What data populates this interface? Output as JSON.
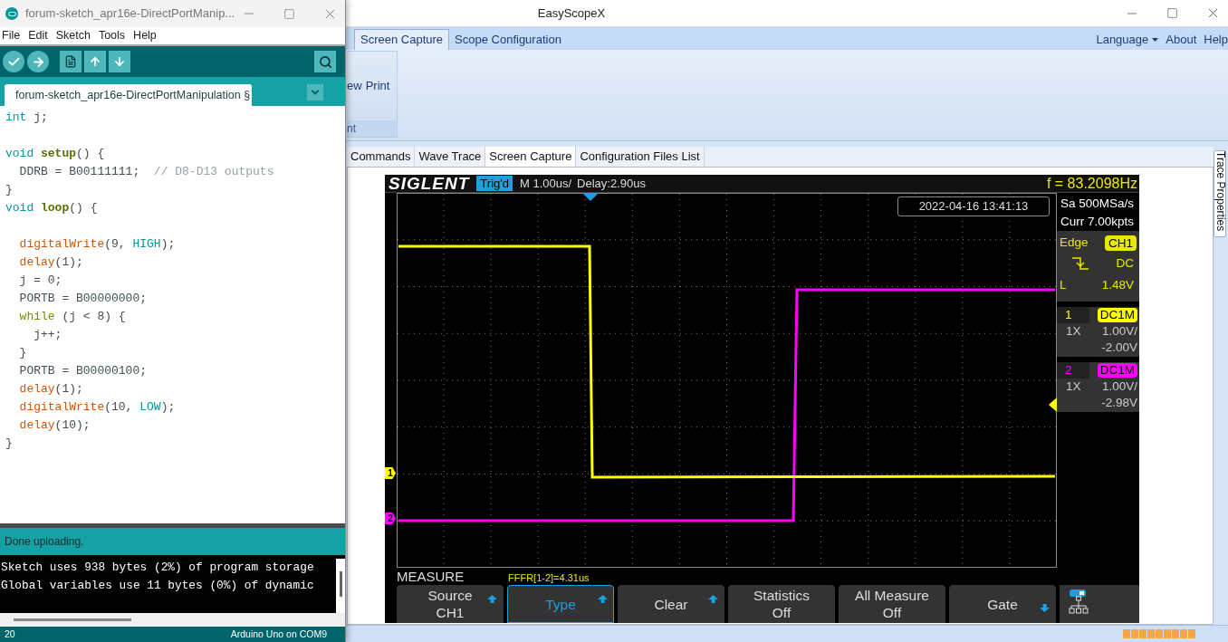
{
  "arduino": {
    "title": "forum-sketch_apr16e-DirectPortManip...",
    "menu": [
      "File",
      "Edit",
      "Sketch",
      "Tools",
      "Help"
    ],
    "tab": "forum-sketch_apr16e-DirectPortManipulation §",
    "code": [
      {
        "kind": "code",
        "tokens": [
          {
            "text": "int",
            "kind": "type"
          },
          {
            "text": " j;",
            "kind": "plain"
          }
        ]
      },
      {
        "kind": "blank"
      },
      {
        "kind": "code",
        "tokens": [
          {
            "text": "void ",
            "kind": "type"
          },
          {
            "text": "setup",
            "kind": "func"
          },
          {
            "text": "() {",
            "kind": "plain"
          }
        ]
      },
      {
        "kind": "code",
        "tokens": [
          {
            "text": "  DDRB = B00111111;  ",
            "kind": "plain"
          },
          {
            "text": "// D8-D13 outputs",
            "kind": "comment"
          }
        ]
      },
      {
        "kind": "code",
        "tokens": [
          {
            "text": "}",
            "kind": "plain"
          }
        ]
      },
      {
        "kind": "code",
        "tokens": [
          {
            "text": "void ",
            "kind": "type"
          },
          {
            "text": "loop",
            "kind": "func"
          },
          {
            "text": "() {",
            "kind": "plain"
          }
        ]
      },
      {
        "kind": "blank"
      },
      {
        "kind": "code",
        "tokens": [
          {
            "text": "  digitalWrite",
            "kind": "builtin"
          },
          {
            "text": "(9, ",
            "kind": "plain"
          },
          {
            "text": "HIGH",
            "kind": "constant"
          },
          {
            "text": ");",
            "kind": "plain"
          }
        ]
      },
      {
        "kind": "code",
        "tokens": [
          {
            "text": "  delay",
            "kind": "builtin"
          },
          {
            "text": "(1);",
            "kind": "plain"
          }
        ]
      },
      {
        "kind": "code",
        "tokens": [
          {
            "text": "  j = 0;",
            "kind": "plain"
          }
        ]
      },
      {
        "kind": "code",
        "tokens": [
          {
            "text": "  PORTB = B00000000;",
            "kind": "plain"
          }
        ]
      },
      {
        "kind": "code",
        "tokens": [
          {
            "text": "  while",
            "kind": "control"
          },
          {
            "text": " (j < 8) {",
            "kind": "plain"
          }
        ]
      },
      {
        "kind": "code",
        "tokens": [
          {
            "text": "    j++;",
            "kind": "plain"
          }
        ]
      },
      {
        "kind": "code",
        "tokens": [
          {
            "text": "  }",
            "kind": "plain"
          }
        ]
      },
      {
        "kind": "code",
        "tokens": [
          {
            "text": "  PORTB = B00000100;",
            "kind": "plain"
          }
        ]
      },
      {
        "kind": "code",
        "tokens": [
          {
            "text": "  delay",
            "kind": "builtin"
          },
          {
            "text": "(1);",
            "kind": "plain"
          }
        ]
      },
      {
        "kind": "code",
        "tokens": [
          {
            "text": "  digitalWrite",
            "kind": "builtin"
          },
          {
            "text": "(10, ",
            "kind": "plain"
          },
          {
            "text": "LOW",
            "kind": "constant"
          },
          {
            "text": ");",
            "kind": "plain"
          }
        ]
      },
      {
        "kind": "code",
        "tokens": [
          {
            "text": "  delay",
            "kind": "builtin"
          },
          {
            "text": "(10);",
            "kind": "plain"
          }
        ]
      },
      {
        "kind": "code",
        "tokens": [
          {
            "text": "}",
            "kind": "plain"
          }
        ]
      }
    ],
    "status": "Done uploading.",
    "console": [
      "Sketch uses 938 bytes (2%) of program storage",
      "Global variables use 11 bytes (0%) of dynamic"
    ],
    "footer": {
      "line": "20",
      "board": "Arduino Uno on COM9"
    }
  },
  "scope_app": {
    "title": "EasyScopeX",
    "ribbon_tabs": [
      {
        "label": "Screen Capture",
        "selected": true
      },
      {
        "label": "Scope Configuration",
        "selected": false
      }
    ],
    "ribbon_links": [
      {
        "label": "Language",
        "kind": "dropdown"
      },
      {
        "label": "About",
        "kind": "link"
      },
      {
        "label": "Help",
        "kind": "link"
      }
    ],
    "ribbon_group": {
      "buttons": [
        "ew",
        "Print"
      ],
      "label": "nt"
    },
    "doc_tabs": [
      {
        "label": "Commands",
        "selected": false
      },
      {
        "label": "Wave Trace",
        "selected": false
      },
      {
        "label": "Screen Capture",
        "selected": true
      },
      {
        "label": "Configuration Files List",
        "selected": false
      }
    ],
    "side_tab": "Trace Properties",
    "scope": {
      "logo": "SIGLENT",
      "trigger_status": "Trig'd",
      "timebase": "M 1.00us/",
      "delay": "Delay:2.90us",
      "frequency": "f = 83.2098Hz",
      "timestamp": "2022-04-16 13:41:13",
      "sample_rate": "Sa 500MSa/s",
      "memory": "Curr 7.00kpts",
      "trigger": {
        "type": "Edge",
        "source": "CH1",
        "falling_edge": true,
        "coupling": "DC",
        "level_label": "L",
        "level_value": "1.48V"
      },
      "channels": [
        {
          "number": "1",
          "coupling": "DC1M",
          "probe": "1X",
          "scale": "1.00V/",
          "offset": "-2.00V",
          "color": "#ffff00"
        },
        {
          "number": "2",
          "coupling": "DC1M",
          "probe": "1X",
          "scale": "1.00V/",
          "offset": "-2.98V",
          "color": "#ff00ff"
        }
      ],
      "trace_markers": [
        {
          "label": "1",
          "color": "#ffff00"
        },
        {
          "label": "2",
          "color": "#ff00ff"
        }
      ],
      "measure_title": "MEASURE",
      "measurement": "FFFR[1-2]=4.31us",
      "softkeys": [
        {
          "label": "Source",
          "value": "CH1",
          "arrow_up": true,
          "arrow_down": false,
          "selected": false
        },
        {
          "label": "Type",
          "arrow_up": true,
          "arrow_down": false,
          "selected": true
        },
        {
          "label": "Clear",
          "arrow_up": true,
          "arrow_down": false,
          "selected": false
        },
        {
          "label": "Statistics",
          "value": "Off",
          "arrow_up": false,
          "arrow_down": false,
          "selected": false
        },
        {
          "label": "All Measure",
          "value": "Off",
          "arrow_up": false,
          "arrow_down": false,
          "selected": false
        },
        {
          "label": "Gate",
          "arrow_up": false,
          "arrow_down": true,
          "selected": false
        }
      ]
    }
  }
}
